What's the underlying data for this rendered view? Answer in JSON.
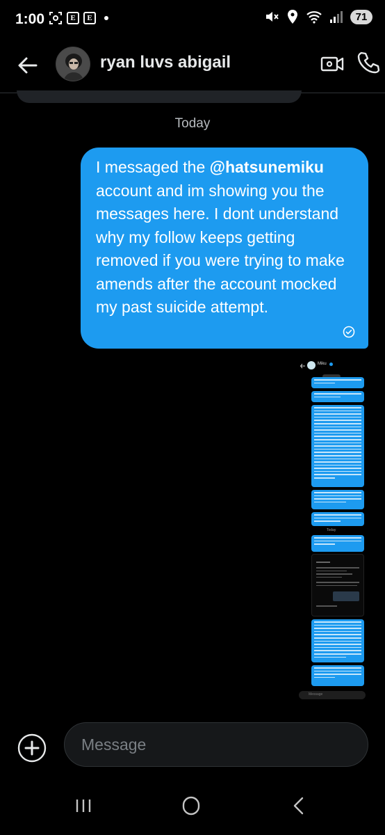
{
  "status_bar": {
    "time": "1:00",
    "battery": "71",
    "left_icons": [
      "screenshot-icon",
      "e-app-icon",
      "e-app-icon",
      "notification-dot"
    ],
    "right_icons": [
      "mute-icon",
      "location-icon",
      "wifi-icon",
      "signal-icon"
    ]
  },
  "header": {
    "contact_name": "ryan luvs abigail",
    "back_icon": "back-arrow-icon",
    "video_icon": "video-call-icon",
    "call_icon": "phone-call-icon"
  },
  "conversation": {
    "date_separator": "Today",
    "outgoing_message": {
      "text_before": "I messaged the ",
      "mention": "@hatsunemiku",
      "text_after": " account and im showing you the messages here. I dont understand why my follow keeps getting removed if you were trying to make amends after the account mocked my past suicide attempt.",
      "status_icon": "seen-check-icon"
    },
    "attached_screenshot": {
      "header_name": "Miku",
      "today_label": "Today",
      "input_placeholder": "Message"
    }
  },
  "composer": {
    "placeholder": "Message",
    "add_icon": "add-plus-icon"
  },
  "nav": {
    "recents_icon": "recents-icon",
    "home_icon": "home-icon",
    "back_icon": "nav-back-icon"
  },
  "colors": {
    "accent": "#1d9bf0",
    "background": "#000000",
    "text": "#e7e9ea"
  }
}
